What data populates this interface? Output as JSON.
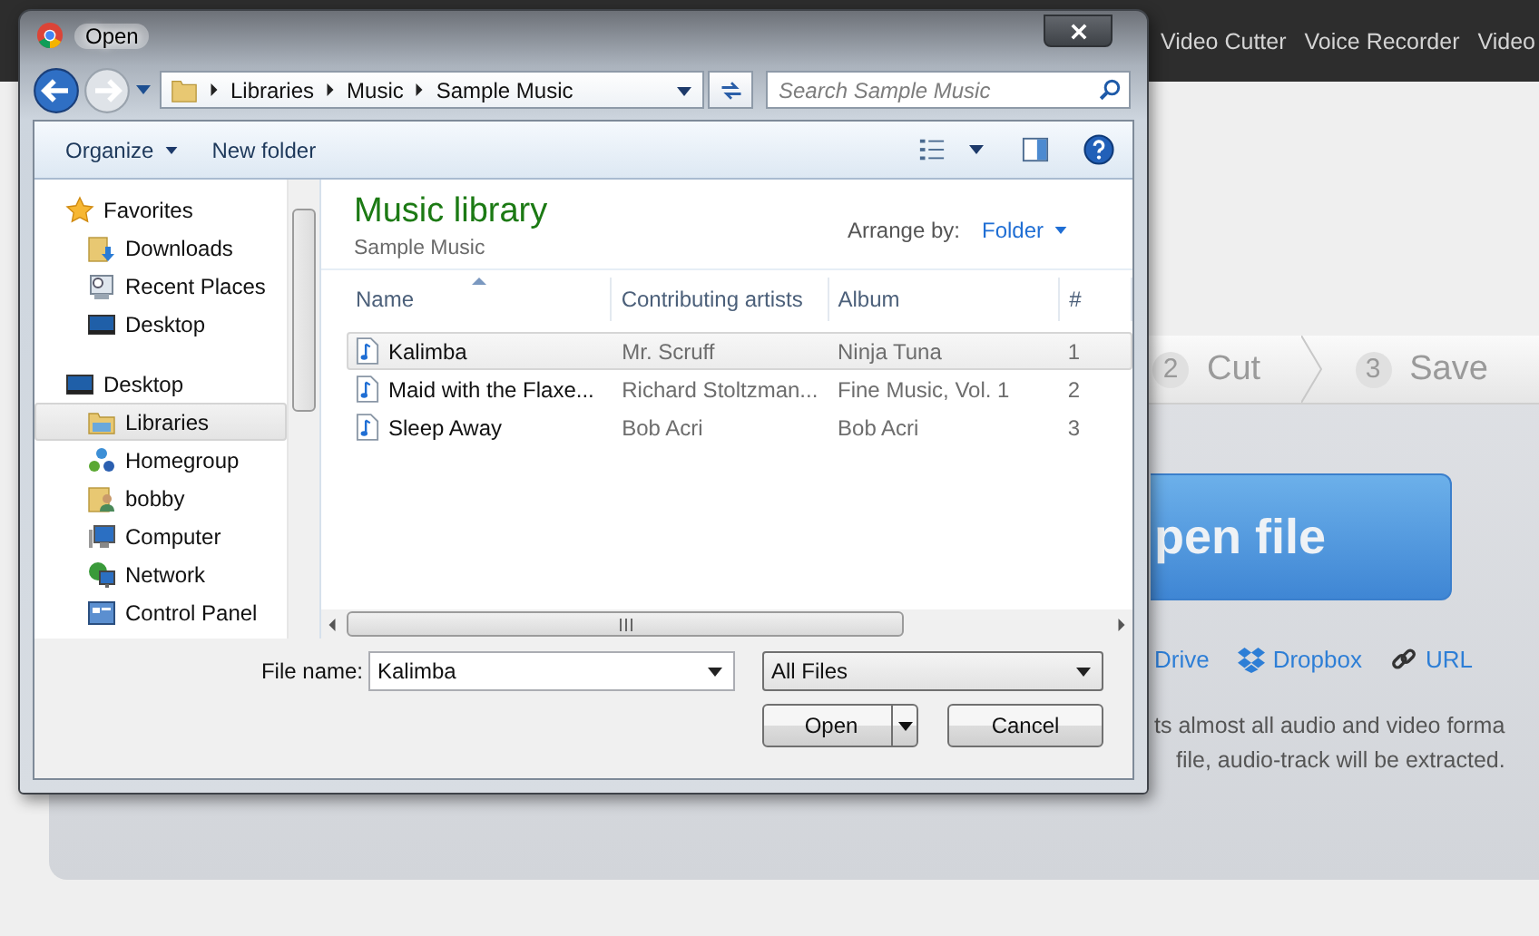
{
  "background_page": {
    "nav": [
      "Video Cutter",
      "Voice Recorder",
      "Video"
    ],
    "steps": [
      {
        "number": "2",
        "label": "Cut"
      },
      {
        "number": "3",
        "label": "Save"
      }
    ],
    "open_button": "pen file",
    "sources": [
      {
        "kind": "drive",
        "label": "Drive"
      },
      {
        "kind": "dropbox",
        "label": "Dropbox"
      },
      {
        "kind": "url",
        "label": "URL"
      }
    ],
    "description": [
      "ts almost all audio and video forma",
      "file, audio-track will be extracted."
    ]
  },
  "dialog": {
    "title": "Open",
    "breadcrumb": [
      "Libraries",
      "Music",
      "Sample Music"
    ],
    "search": {
      "placeholder": "Search Sample Music"
    },
    "toolbar": [
      {
        "label": "Organize",
        "menu": true
      },
      {
        "label": "New folder",
        "menu": false
      }
    ],
    "navigation": [
      {
        "label": "Favorites",
        "kind": "favorites",
        "selected": false,
        "children": [
          {
            "label": "Downloads",
            "kind": "downloads",
            "selected": false
          },
          {
            "label": "Recent Places",
            "kind": "recent",
            "selected": false
          },
          {
            "label": "Desktop",
            "kind": "desktop",
            "selected": false
          }
        ]
      },
      {
        "label": "Desktop",
        "kind": "desktop",
        "selected": false,
        "children": [
          {
            "label": "Libraries",
            "kind": "libraries",
            "selected": true
          },
          {
            "label": "Homegroup",
            "kind": "homegroup",
            "selected": false
          },
          {
            "label": "bobby",
            "kind": "user",
            "selected": false
          },
          {
            "label": "Computer",
            "kind": "computer",
            "selected": false
          },
          {
            "label": "Network",
            "kind": "network",
            "selected": false
          },
          {
            "label": "Control Panel",
            "kind": "control_panel",
            "selected": false
          }
        ]
      }
    ],
    "library": {
      "title": "Music library",
      "subtitle": "Sample Music",
      "arrange_label": "Arrange by:",
      "arrange_value": "Folder"
    },
    "table": {
      "columns": [
        {
          "label": "Name",
          "sorted": true
        },
        {
          "label": "Contributing artists",
          "sorted": false
        },
        {
          "label": "Album",
          "sorted": false
        },
        {
          "label": "#",
          "sorted": false
        }
      ],
      "rows": [
        {
          "cells": [
            "Kalimba",
            "Mr. Scruff",
            "Ninja Tuna",
            "1"
          ],
          "selected": true
        },
        {
          "cells": [
            "Maid with the Flaxe...",
            "Richard Stoltzman...",
            "Fine Music, Vol. 1",
            "2"
          ],
          "selected": false
        },
        {
          "cells": [
            "Sleep Away",
            "Bob Acri",
            "Bob Acri",
            "3"
          ],
          "selected": false
        }
      ]
    },
    "file_name": {
      "label": "File name:",
      "value": "Kalimba"
    },
    "file_type": "All Files",
    "buttons": [
      {
        "label": "Open",
        "kind": "split"
      },
      {
        "label": "Cancel",
        "kind": "plain"
      }
    ]
  }
}
